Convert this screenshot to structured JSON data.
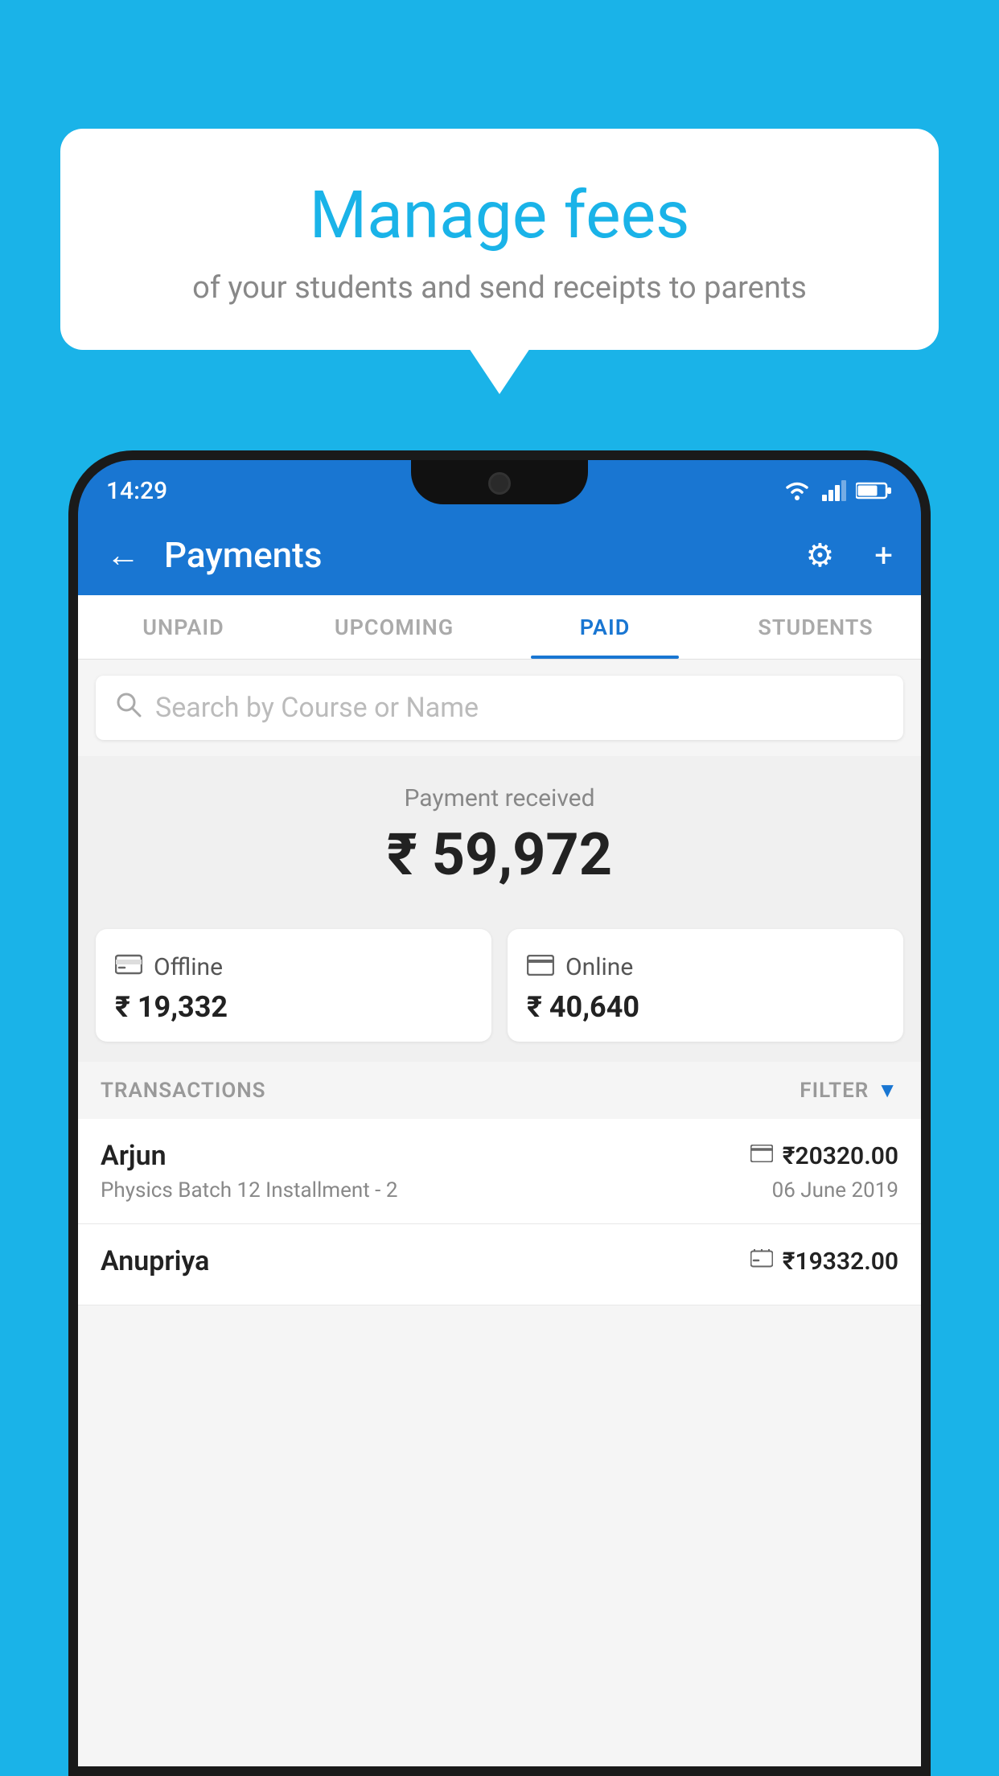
{
  "background_color": "#1ab3e8",
  "speech_bubble": {
    "title": "Manage fees",
    "subtitle": "of your students and send receipts to parents"
  },
  "status_bar": {
    "time": "14:29"
  },
  "app_header": {
    "title": "Payments",
    "back_label": "←",
    "settings_label": "⚙",
    "add_label": "+"
  },
  "tabs": [
    {
      "label": "UNPAID",
      "active": false
    },
    {
      "label": "UPCOMING",
      "active": false
    },
    {
      "label": "PAID",
      "active": true
    },
    {
      "label": "STUDENTS",
      "active": false
    }
  ],
  "search": {
    "placeholder": "Search by Course or Name"
  },
  "payment_received": {
    "label": "Payment received",
    "amount": "₹ 59,972"
  },
  "payment_cards": [
    {
      "type": "Offline",
      "amount": "₹ 19,332",
      "icon": "💴"
    },
    {
      "type": "Online",
      "amount": "₹ 40,640",
      "icon": "💳"
    }
  ],
  "transactions_section": {
    "label": "TRANSACTIONS",
    "filter_label": "FILTER"
  },
  "transactions": [
    {
      "name": "Arjun",
      "course": "Physics Batch 12 Installment - 2",
      "amount": "₹20320.00",
      "date": "06 June 2019",
      "payment_icon": "💳"
    },
    {
      "name": "Anupriya",
      "course": "",
      "amount": "₹19332.00",
      "date": "",
      "payment_icon": "💴"
    }
  ]
}
